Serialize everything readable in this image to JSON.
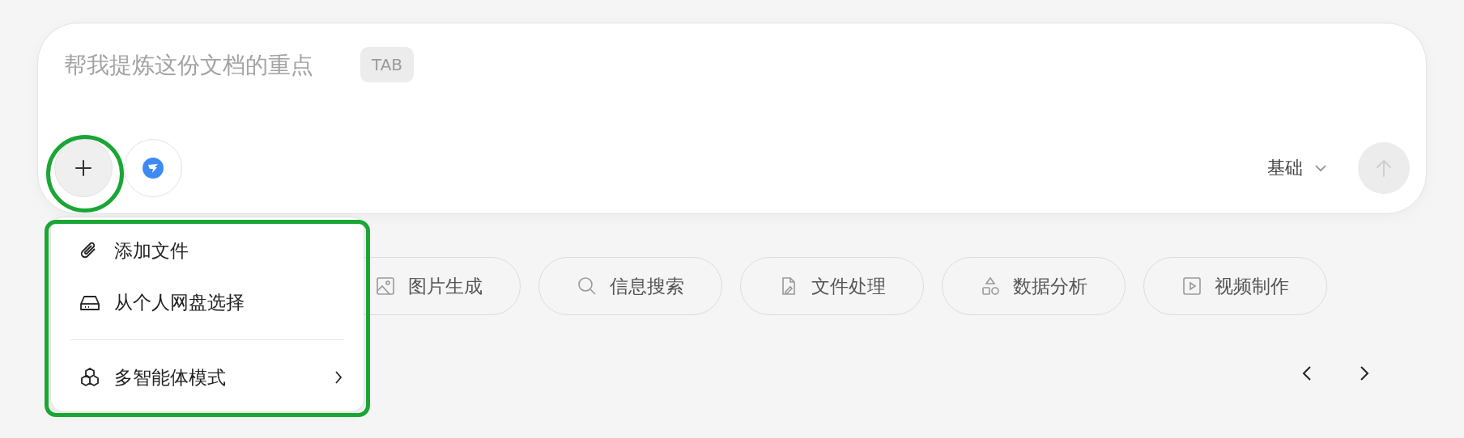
{
  "composer": {
    "placeholder": "帮我提炼这份文档的重点",
    "shortcut": "TAB",
    "mode": "基础"
  },
  "chips": [
    {
      "label": "图片生成",
      "kind": "image"
    },
    {
      "label": "信息搜索",
      "kind": "search"
    },
    {
      "label": "文件处理",
      "kind": "file"
    },
    {
      "label": "数据分析",
      "kind": "shapes"
    },
    {
      "label": "视频制作",
      "kind": "video"
    }
  ],
  "menu": {
    "groups": [
      [
        {
          "label": "添加文件",
          "kind": "attach",
          "submenu": false
        },
        {
          "label": "从个人网盘选择",
          "kind": "drive",
          "submenu": false
        }
      ],
      [
        {
          "label": "多智能体模式",
          "kind": "agents",
          "submenu": true
        }
      ]
    ]
  }
}
